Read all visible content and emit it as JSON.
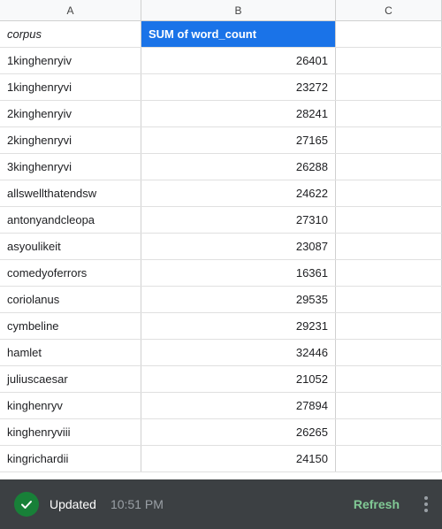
{
  "columns": {
    "a": "A",
    "b": "B",
    "c": "C"
  },
  "header_row": {
    "col_a": "corpus",
    "col_b": "SUM of word_count"
  },
  "rows": [
    {
      "corpus": "1kinghenryiv",
      "count": "26401"
    },
    {
      "corpus": "1kinghenryvi",
      "count": "23272"
    },
    {
      "corpus": "2kinghenryiv",
      "count": "28241"
    },
    {
      "corpus": "2kinghenryvi",
      "count": "27165"
    },
    {
      "corpus": "3kinghenryvi",
      "count": "26288"
    },
    {
      "corpus": "allswellthatendsw",
      "count": "24622"
    },
    {
      "corpus": "antonyandcleopa",
      "count": "27310"
    },
    {
      "corpus": "asyoulikeit",
      "count": "23087"
    },
    {
      "corpus": "comedyoferrors",
      "count": "16361"
    },
    {
      "corpus": "coriolanus",
      "count": "29535"
    },
    {
      "corpus": "cymbeline",
      "count": "29231"
    },
    {
      "corpus": "hamlet",
      "count": "32446"
    },
    {
      "corpus": "juliuscaesar",
      "count": "21052"
    },
    {
      "corpus": "kinghenryv",
      "count": "27894"
    },
    {
      "corpus": "kinghenryviii",
      "count": "26265"
    },
    {
      "corpus": "kingrichardii",
      "count": "24150"
    }
  ],
  "toast": {
    "status": "Updated",
    "time": "10:51 PM",
    "refresh_label": "Refresh"
  }
}
